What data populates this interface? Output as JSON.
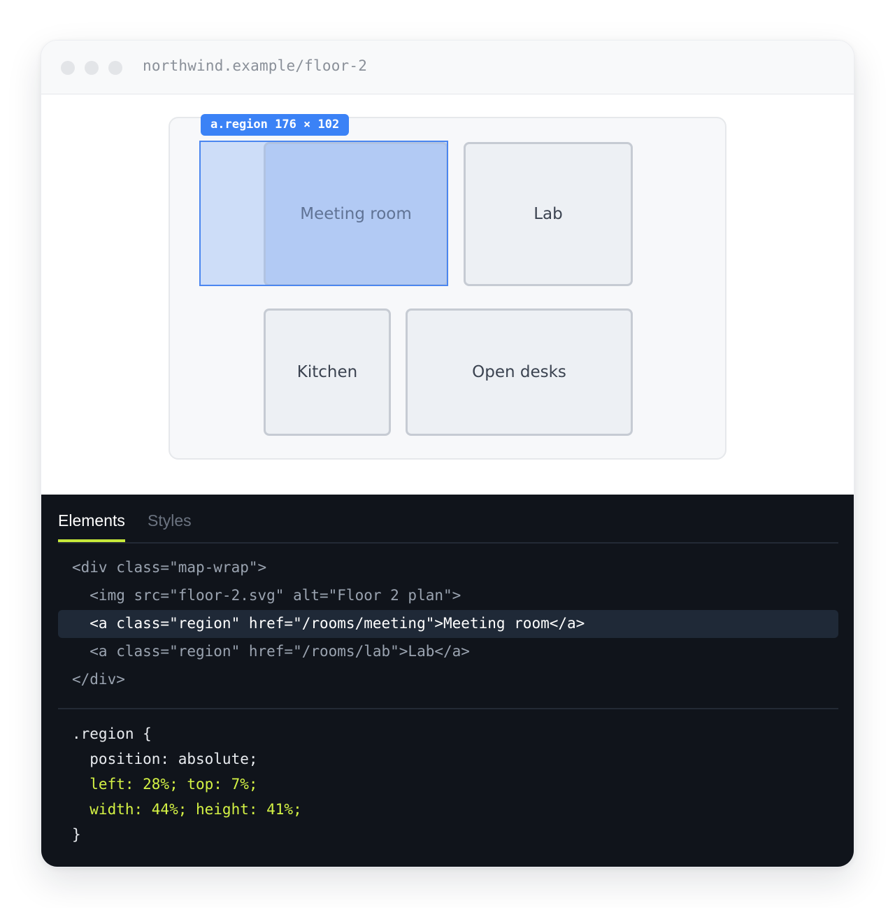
{
  "browser": {
    "url": "northwind.example/floor-2"
  },
  "map": {
    "inspect_tag": "a.region 176 × 102",
    "rooms": {
      "meeting": "Meeting room",
      "lab": "Lab",
      "kitchen": "Kitchen",
      "open_desks": "Open desks"
    }
  },
  "devtools": {
    "tabs": [
      "Elements",
      "Styles"
    ],
    "active_tab": "Elements",
    "html_lines": [
      "<div class=\"map-wrap\">",
      "  <img src=\"floor-2.svg\" alt=\"Floor 2 plan\">",
      "  <a class=\"region\" href=\"/rooms/meeting\">Meeting room</a>",
      "  <a class=\"region\" href=\"/rooms/lab\">Lab</a>",
      "</div>"
    ],
    "selected_line_index": 2,
    "css_lines": [
      ".region {",
      "  position: absolute;",
      "  left: 28%; top: 7%;",
      "  width: 44%; height: 41%;",
      "}"
    ]
  },
  "colors": {
    "accent": "#3b82f6",
    "highlight": "#c6e83a",
    "devtools_bg": "#10141b"
  },
  "icons": [
    "window-close-dot-icon",
    "window-minimize-dot-icon",
    "window-maximize-dot-icon"
  ]
}
